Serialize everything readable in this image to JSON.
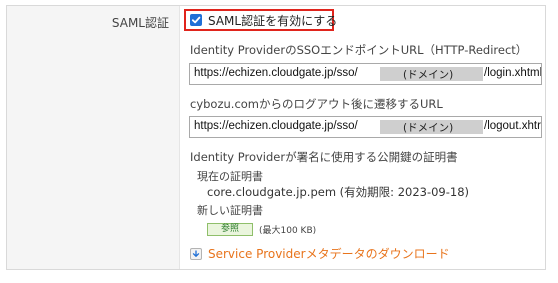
{
  "section": {
    "label": "SAML認証"
  },
  "enable": {
    "checked": true,
    "label": "SAML認証を有効にする"
  },
  "sso": {
    "title": "Identity ProviderのSSOエンドポイントURL（HTTP-Redirect）",
    "url_prefix": "https://echizen.cloudgate.jp/sso/",
    "masked_label": "(ドメイン)",
    "url_suffix": "/login.xhtml"
  },
  "logout": {
    "title": "cybozu.comからのログアウト後に遷移するURL",
    "url_prefix": "https://echizen.cloudgate.jp/sso/",
    "masked_label": "(ドメイン)",
    "url_suffix": "/logout.xhtr"
  },
  "certificate": {
    "title": "Identity Providerが署名に使用する公開鍵の証明書",
    "current_label": "現在の証明書",
    "current_value": "core.cloudgate.jp.pem (有効期限: 2023-09-18)",
    "new_label": "新しい証明書",
    "browse_label": "参照",
    "size_note": "(最大100 KB)"
  },
  "download": {
    "label": "Service Providerメタデータのダウンロード"
  },
  "colors": {
    "accent_red": "#e0241c",
    "checkbox_blue": "#1f6fd6",
    "link_orange": "#e8741c",
    "label_bg": "#f5f5f5",
    "mask_gray": "#cfcfcf"
  },
  "icons": {
    "checkbox": "checkmark-icon",
    "download": "download-icon"
  }
}
